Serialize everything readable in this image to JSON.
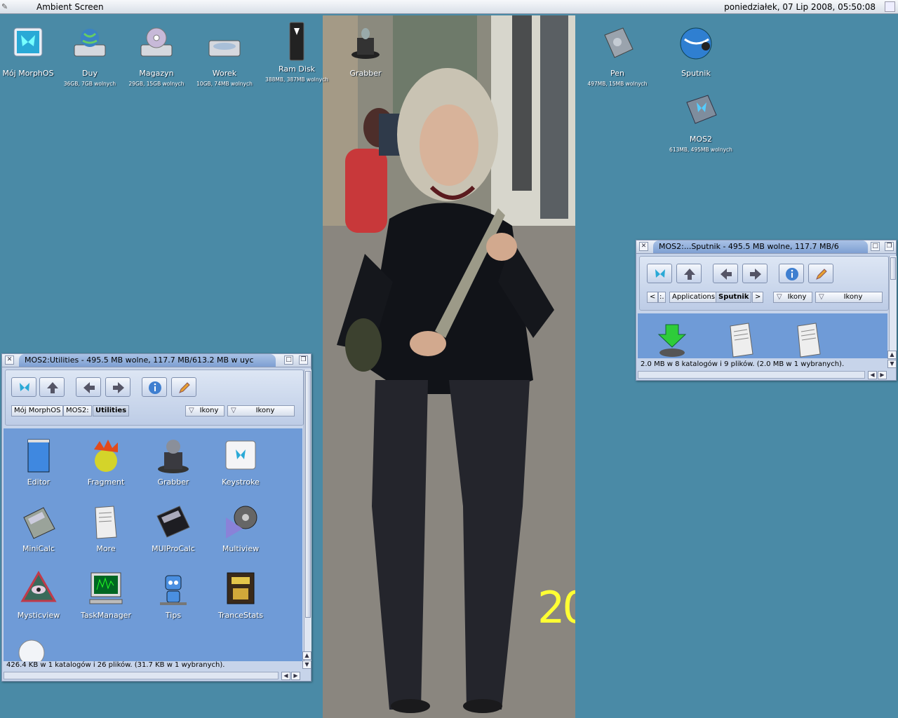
{
  "menubar": {
    "title": "Ambient Screen",
    "clock": "poniedziałek, 07 Lip 2008, 05:50:08"
  },
  "desktop_icons": [
    {
      "label": "Mój MorphOS",
      "sub": "",
      "icon": "morphos-butterfly-icon"
    },
    {
      "label": "Duy",
      "sub": "36GB, 7GB wolnych",
      "icon": "harddisk-globe-icon"
    },
    {
      "label": "Magazyn",
      "sub": "29GB, 15GB wolnych",
      "icon": "harddisk-cd-icon"
    },
    {
      "label": "Worek",
      "sub": "10GB, 74MB wolnych",
      "icon": "harddisk-icon"
    },
    {
      "label": "Ram Disk",
      "sub": "388MB, 387MB wolnych",
      "icon": "ram-chip-icon"
    },
    {
      "label": "Grabber",
      "sub": "",
      "icon": "grabber-hat-icon"
    },
    {
      "label": "Pen",
      "sub": "497MB, 15MB wolnych",
      "icon": "usb-pen-icon"
    },
    {
      "label": "Sputnik",
      "sub": "",
      "icon": "sputnik-globe-icon"
    },
    {
      "label": "MOS2",
      "sub": "613MB, 495MB wolnych",
      "icon": "morphos-disk-icon"
    }
  ],
  "photo": {
    "overlay_text": "20"
  },
  "win_utilities": {
    "title": "MOS2:Utilities - 495.5 MB wolne, 117.7 MB/613.2 MB w uyc",
    "path": [
      "Mój MorphOS",
      "MOS2:",
      "Utilities"
    ],
    "view1": "Ikony",
    "view2": "Ikony",
    "icons": [
      {
        "label": "Editor"
      },
      {
        "label": "Fragment"
      },
      {
        "label": "Grabber"
      },
      {
        "label": "Keystroke"
      },
      {
        "label": "MiniCalc"
      },
      {
        "label": "More"
      },
      {
        "label": "MUIProCalc"
      },
      {
        "label": "Multiview"
      },
      {
        "label": "Mysticview"
      },
      {
        "label": "TaskManager"
      },
      {
        "label": "Tips"
      },
      {
        "label": "TranceStats"
      }
    ],
    "status": "426.4 KB w 1 katalogów i 26 plików. (31.7 KB w 1 wybranych)."
  },
  "win_sputnik": {
    "title": "MOS2:...Sputnik - 495.5 MB wolne, 117.7 MB/6",
    "path_prev": "<",
    "path_dots": ":.",
    "path": [
      "Applications",
      "Sputnik"
    ],
    "path_next": ">",
    "view1": "Ikony",
    "view2": "Ikony",
    "status": "2.0 MB w 8 katalogów i 9 plików. (2.0 MB w 1 wybranych)."
  }
}
